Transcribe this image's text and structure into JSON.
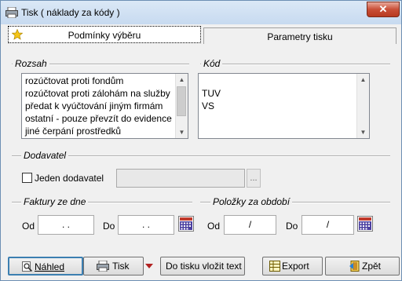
{
  "window": {
    "title": "Tisk ( náklady za kódy )",
    "close_label": "✕"
  },
  "tabs": [
    {
      "label": "Podmínky výběru",
      "icon": "star-icon",
      "active": true
    },
    {
      "label": "Parametry tisku",
      "active": false
    }
  ],
  "rozsah": {
    "label": "Rozsah",
    "items": [
      "rozúčtovat proti fondům",
      "rozúčtovat proti zálohám na služby",
      "předat k vyúčtování jiným firmám",
      "ostatní - pouze převzít do evidence",
      "jiné čerpání prostředků"
    ]
  },
  "kod": {
    "label": "Kód",
    "items": [
      "TUV",
      "VS"
    ]
  },
  "dodavatel": {
    "label": "Dodavatel",
    "checkbox_label": "Jeden dodavatel",
    "checked": false,
    "value": "",
    "browse_label": "..."
  },
  "faktury": {
    "label": "Faktury ze dne",
    "od_label": "Od",
    "od_value": "  .  .",
    "do_label": "Do",
    "do_value": "  .  ."
  },
  "polozky": {
    "label": "Položky za období",
    "od_label": "Od",
    "od_value": "/",
    "do_label": "Do",
    "do_value": "/"
  },
  "buttons": {
    "nahled": "Náhled",
    "tisk": "Tisk",
    "vlozit": "Do tisku vložit text",
    "export": "Export",
    "zpet": "Zpět"
  },
  "colors": {
    "title_bar": "#c7daf0",
    "close": "#c94f37",
    "calendar": "#4b3fa0",
    "accent_red": "#b22222"
  }
}
